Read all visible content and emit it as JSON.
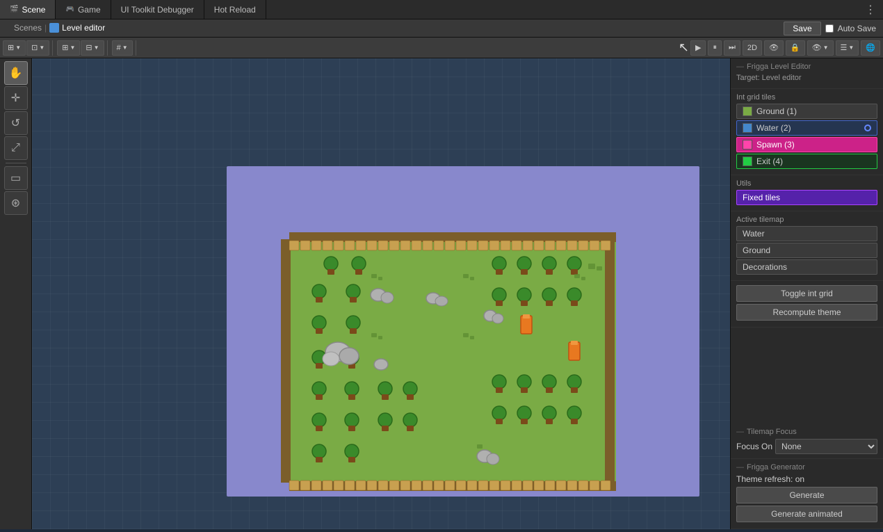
{
  "tabs": [
    {
      "label": "Scene",
      "icon": "🎬",
      "active": false
    },
    {
      "label": "Game",
      "icon": "🎮",
      "active": false
    },
    {
      "label": "UI Toolkit Debugger",
      "icon": "",
      "active": false
    },
    {
      "label": "Hot Reload",
      "icon": "",
      "active": false
    }
  ],
  "breadcrumb": {
    "scenes_label": "Scenes",
    "separator": "|",
    "editor_label": "Level editor",
    "editor_icon": "cube"
  },
  "toolbar": {
    "save_label": "Save",
    "autosave_label": "Auto Save",
    "mode_2d": "2D"
  },
  "right_panel": {
    "title": "Frigga Level Editor",
    "target_label": "Target: Level editor",
    "int_grid_label": "Int grid tiles",
    "tiles": [
      {
        "label": "Ground (1)",
        "color": "ground"
      },
      {
        "label": "Water (2)",
        "color": "water",
        "dot": true
      },
      {
        "label": "Spawn (3)",
        "color": "spawn",
        "selected": "spawn"
      },
      {
        "label": "Exit (4)",
        "color": "exit",
        "selected": "exit"
      }
    ],
    "utils_label": "Utils",
    "fixed_tiles_label": "Fixed tiles",
    "active_tilemap_label": "Active tilemap",
    "tilemaps": [
      {
        "label": "Water"
      },
      {
        "label": "Ground"
      },
      {
        "label": "Decorations"
      }
    ],
    "toggle_int_grid": "Toggle int grid",
    "recompute_theme": "Recompute theme",
    "tilemap_focus_title": "Tilemap Focus",
    "focus_on_label": "Focus On",
    "focus_none": "None",
    "generator_title": "Frigga Generator",
    "theme_refresh": "Theme refresh: on",
    "generate_label": "Generate",
    "generate_animated_label": "Generate animated"
  }
}
